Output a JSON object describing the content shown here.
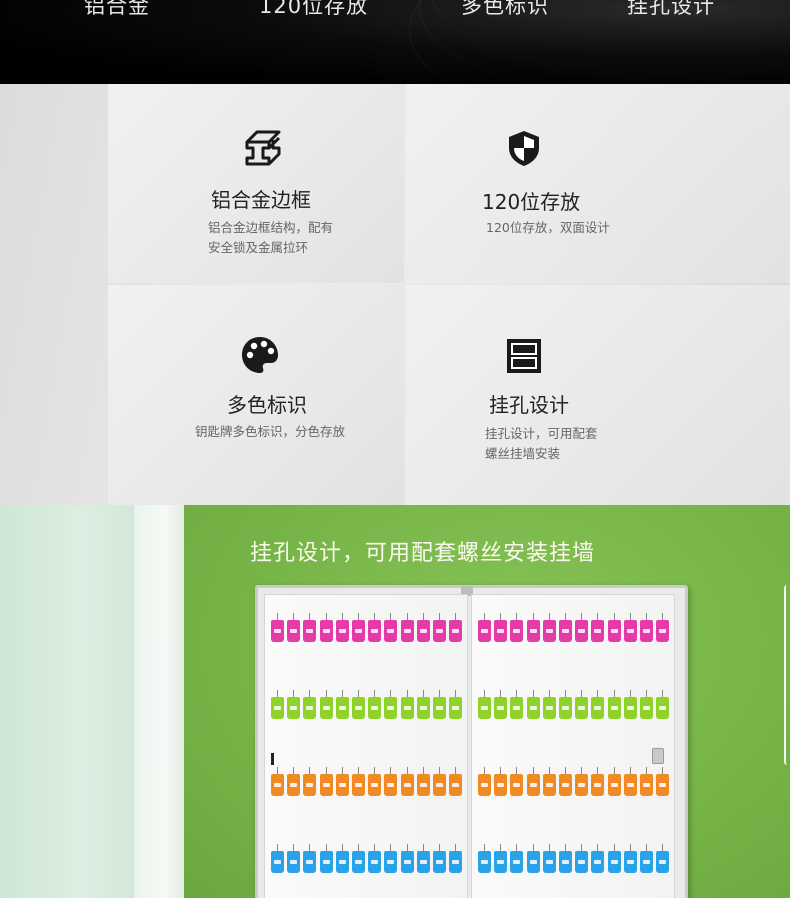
{
  "top_band": {
    "labels": [
      "铝合金",
      "120位存放",
      "多色标识",
      "挂孔设计"
    ]
  },
  "features": [
    {
      "title": "铝合金边框",
      "desc_lines": [
        "铝合金边框结构，配有",
        "安全锁及金属拉环"
      ],
      "icon": "aluminum-profile-icon"
    },
    {
      "title": "120位存放",
      "desc_lines": [
        "120位存放，双面设计"
      ],
      "icon": "shield-icon"
    },
    {
      "title": "多色标识",
      "desc_lines": [
        "钥匙牌多色标识，分色存放"
      ],
      "icon": "palette-icon"
    },
    {
      "title": "挂孔设计",
      "desc_lines": [
        "挂孔设计，可用配套",
        "螺丝挂墙安装"
      ],
      "icon": "cabinet-icon"
    }
  ],
  "photo": {
    "caption": "挂孔设计，可用配套螺丝安装挂墙",
    "tag_colors": [
      "#e63aa8",
      "#8fd22b",
      "#f28a24",
      "#2aa3e6"
    ]
  },
  "colors": {
    "top_band": "#000000",
    "feature_bg": "#e8e8e8",
    "wall_green": "#78b548",
    "icon": "#1a1a1a"
  }
}
